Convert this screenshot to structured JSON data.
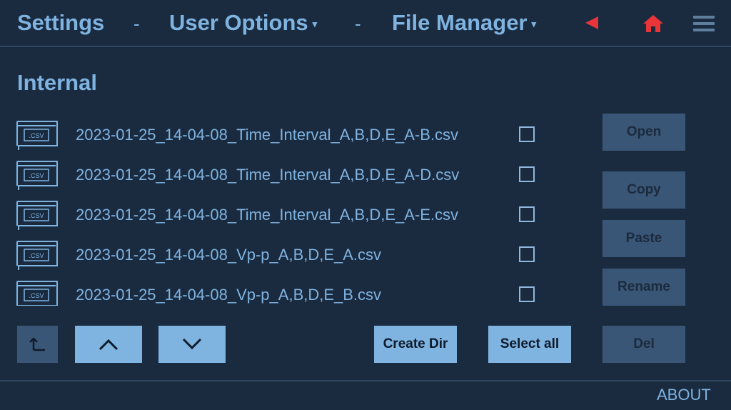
{
  "header": {
    "settings": "Settings",
    "sep1": "-",
    "user_options": "User Options",
    "sep2": "-",
    "file_manager": "File Manager",
    "caret": "▾",
    "back_icon": "back-triangle-icon",
    "home_icon": "home-icon",
    "menu_icon": "hamburger-menu-icon",
    "accent_color": "#e8353a"
  },
  "section": {
    "title": "Internal"
  },
  "files": [
    {
      "ext_label": ".CSV",
      "name": "2023-01-25_14-04-08_Time_Interval_A,B,D,E_A-B.csv",
      "checked": false
    },
    {
      "ext_label": ".CSV",
      "name": "2023-01-25_14-04-08_Time_Interval_A,B,D,E_A-D.csv",
      "checked": false
    },
    {
      "ext_label": ".CSV",
      "name": "2023-01-25_14-04-08_Time_Interval_A,B,D,E_A-E.csv",
      "checked": false
    },
    {
      "ext_label": ".CSV",
      "name": "2023-01-25_14-04-08_Vp-p_A,B,D,E_A.csv",
      "checked": false
    },
    {
      "ext_label": ".CSV",
      "name": "2023-01-25_14-04-08_Vp-p_A,B,D,E_B.csv",
      "checked": false
    }
  ],
  "actions": {
    "open": "Open",
    "copy": "Copy",
    "paste": "Paste",
    "rename": "Rename",
    "del": "Del",
    "create_dir": "Create Dir",
    "select_all": "Select all"
  },
  "nav_buttons": {
    "parent_dir_icon": "parent-directory-icon",
    "up_icon": "chevron-up-icon",
    "down_icon": "chevron-down-icon"
  },
  "footer": {
    "about": "ABOUT"
  }
}
